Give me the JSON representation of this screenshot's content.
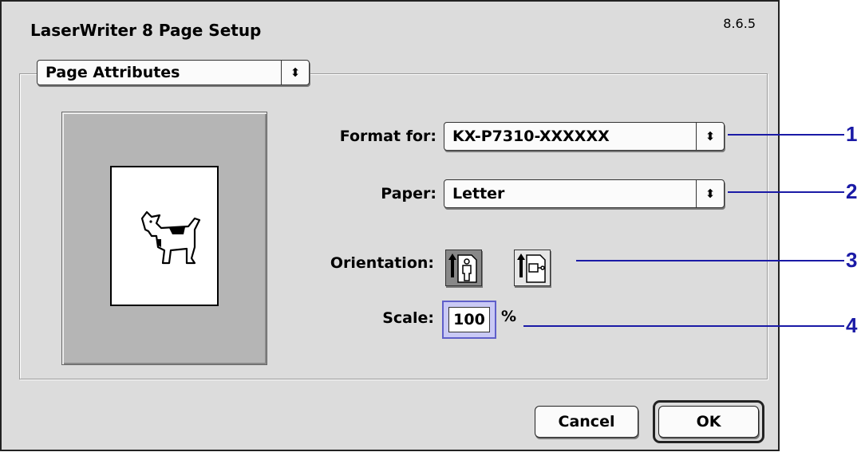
{
  "dialog": {
    "title": "LaserWriter 8 Page Setup",
    "version": "8.6.5"
  },
  "section_popup": {
    "value": "Page Attributes",
    "arrows": "⬍"
  },
  "format_for": {
    "label": "Format for:",
    "value": "KX-P7310-XXXXXX",
    "arrows": "⬍"
  },
  "paper": {
    "label": "Paper:",
    "value": "Letter",
    "arrows": "⬍"
  },
  "orientation": {
    "label": "Orientation:",
    "options": [
      {
        "name": "portrait",
        "selected": true
      },
      {
        "name": "landscape",
        "selected": false
      }
    ]
  },
  "scale": {
    "label": "Scale:",
    "value": "100",
    "unit": "%"
  },
  "buttons": {
    "cancel": "Cancel",
    "ok": "OK"
  },
  "callouts": [
    "1",
    "2",
    "3",
    "4"
  ],
  "colors": {
    "callout": "#1a1aa6",
    "dialog_bg": "#dcdcdc",
    "focus": "#5f5fc9"
  }
}
